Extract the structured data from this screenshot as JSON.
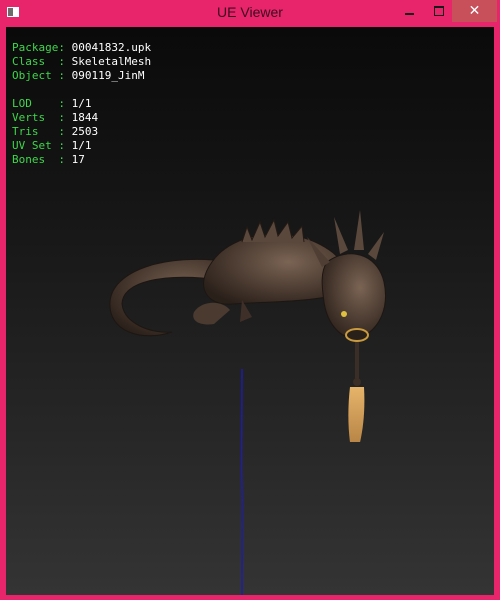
{
  "window": {
    "title": "UE Viewer",
    "frame_color": "#e8246a",
    "close_button_color": "#c7505a"
  },
  "titlebar_buttons": {
    "minimize_icon": "minimize-icon",
    "maximize_icon": "maximize-icon",
    "close_icon": "close-icon",
    "close_glyph": "✕"
  },
  "info": {
    "package": {
      "label": "Package:",
      "value": "00041832.upk"
    },
    "class": {
      "label": "Class  :",
      "value": "SkeletalMesh"
    },
    "object": {
      "label": "Object :",
      "value": "090119_JinM"
    },
    "lod": {
      "label": "LOD    :",
      "value": "1/1"
    },
    "verts": {
      "label": "Verts  :",
      "value": "1844"
    },
    "tris": {
      "label": "Tris   :",
      "value": "2503"
    },
    "uvset": {
      "label": "UV Set :",
      "value": "1/1"
    },
    "bones": {
      "label": "Bones  :",
      "value": "17"
    },
    "label_color": "#3dd84a",
    "value_color": "#ffffff"
  },
  "viewport": {
    "model_icon": "dragon-mesh",
    "axis_color": "#1c1cb4"
  }
}
